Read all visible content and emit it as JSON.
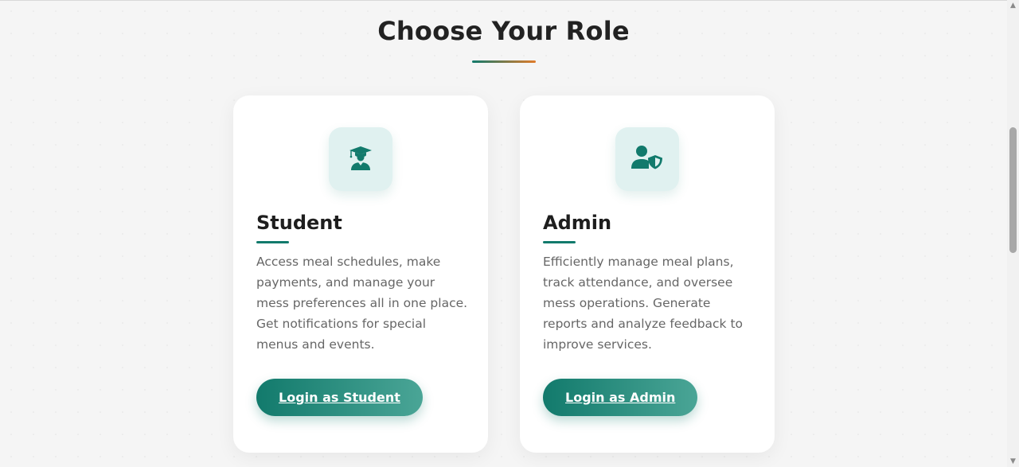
{
  "section": {
    "title": "Choose Your Role"
  },
  "roles": [
    {
      "title": "Student",
      "description": "Access meal schedules, make payments, and manage your mess preferences all in one place. Get notifications for special menus and events.",
      "button_label": "Login as Student",
      "icon": "user-graduate-icon"
    },
    {
      "title": "Admin",
      "description": "Efficiently manage meal plans, track attendance, and oversee mess operations. Generate reports and analyze feedback to improve services.",
      "button_label": "Login as Admin",
      "icon": "user-shield-icon"
    }
  ],
  "colors": {
    "primary": "#127a6c",
    "accent": "#e07b2a",
    "background": "#f5f5f5",
    "card": "#ffffff",
    "icon_bg": "#e0f1f0"
  },
  "scrollbar": {
    "up_icon": "triangle-up-icon",
    "down_icon": "triangle-down-icon"
  }
}
